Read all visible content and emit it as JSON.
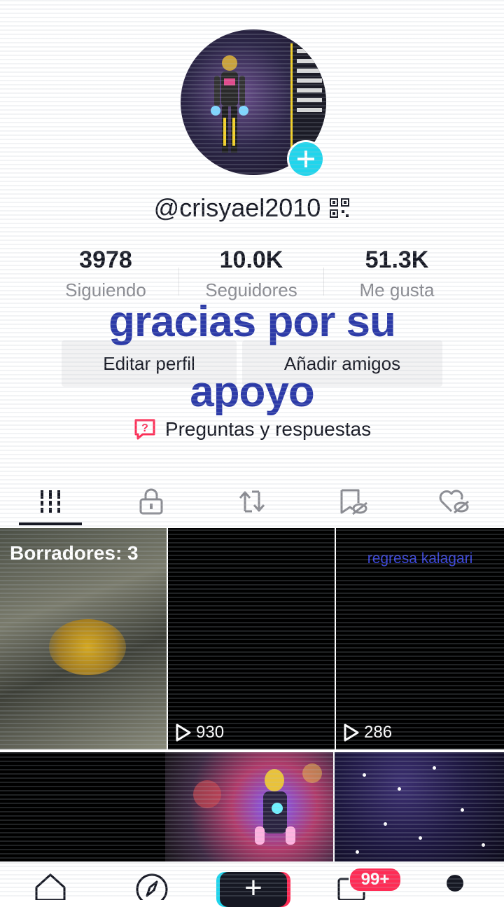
{
  "profile": {
    "username": "@crisyael2010",
    "stats": [
      {
        "value": "3978",
        "label": "Siguiendo"
      },
      {
        "value": "10.0K",
        "label": "Seguidores"
      },
      {
        "value": "51.3K",
        "label": "Me gusta"
      }
    ]
  },
  "overlay": {
    "line1": "gracias por su",
    "line2": "apoyo"
  },
  "actions": {
    "edit_profile": "Editar perfil",
    "add_friends": "Añadir amigos"
  },
  "qa": {
    "label": "Preguntas y respuestas"
  },
  "tabs": [
    {
      "icon": "grid-icon"
    },
    {
      "icon": "lock-icon"
    },
    {
      "icon": "repost-icon"
    },
    {
      "icon": "bookmark-hidden-icon"
    },
    {
      "icon": "heart-hidden-icon"
    }
  ],
  "videos": [
    {
      "drafts": "Borradores: 3"
    },
    {
      "views": "930"
    },
    {
      "caption": "regresa kalagari",
      "views": "286"
    },
    {},
    {},
    {}
  ],
  "nav": {
    "inbox_badge": "99+"
  },
  "colors": {
    "accent": "#20d5ec",
    "brand_red": "#fe2c55",
    "caption_blue": "#2c3aa8"
  }
}
